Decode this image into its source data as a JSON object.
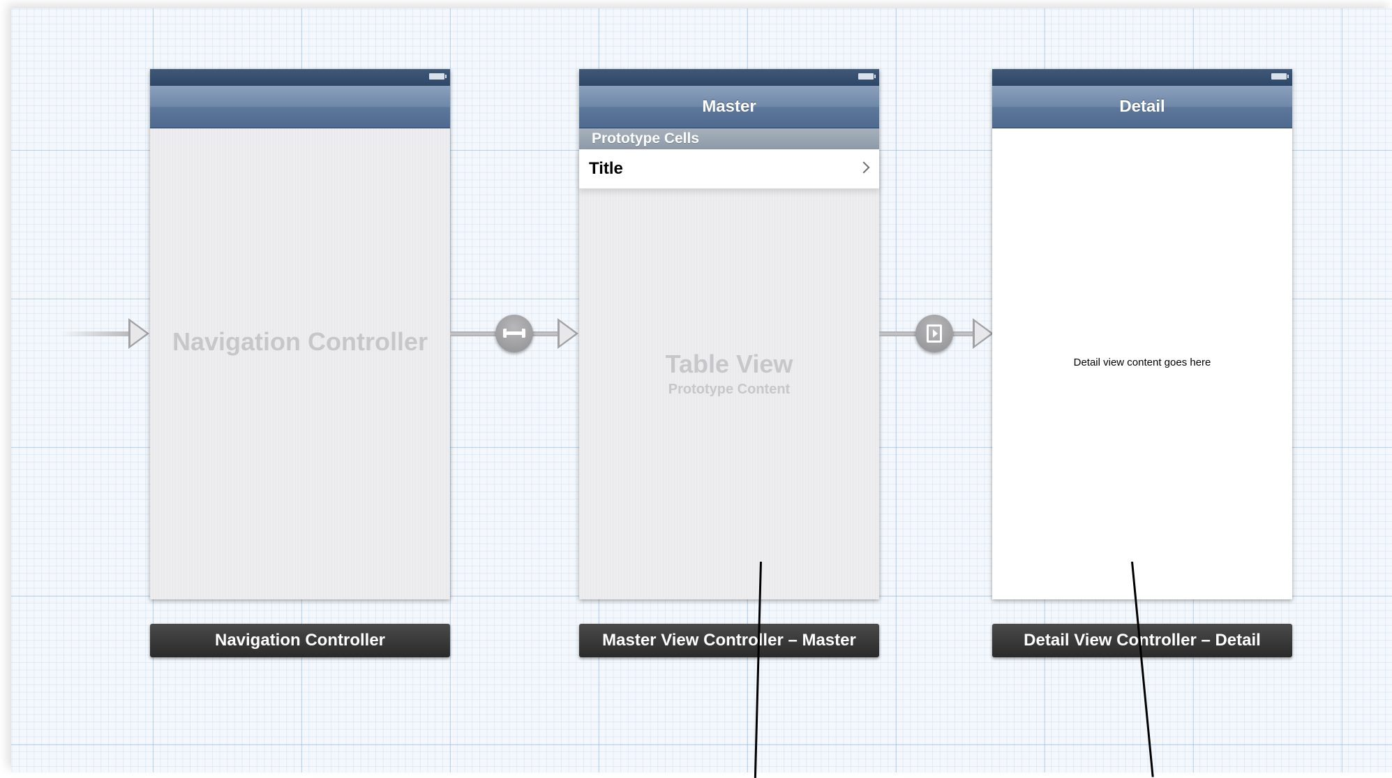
{
  "scenes": {
    "navigation_controller": {
      "placeholder": "Navigation Controller",
      "caption": "Navigation Controller"
    },
    "master": {
      "nav_title": "Master",
      "section_header": "Prototype Cells",
      "cell_title": "Title",
      "placeholder_title": "Table View",
      "placeholder_subtitle": "Prototype Content",
      "caption": "Master View Controller – Master"
    },
    "detail": {
      "nav_title": "Detail",
      "body_text": "Detail view content goes here",
      "caption": "Detail View Controller – Detail"
    }
  },
  "segues": {
    "initial": "entry-arrow",
    "relationship": "relationship-segue-icon",
    "push": "push-segue-icon"
  },
  "colors": {
    "canvas_grid": "#96b9dc",
    "nav_bar": "#6f88a9",
    "caption_bg": "#2a2a2a"
  }
}
